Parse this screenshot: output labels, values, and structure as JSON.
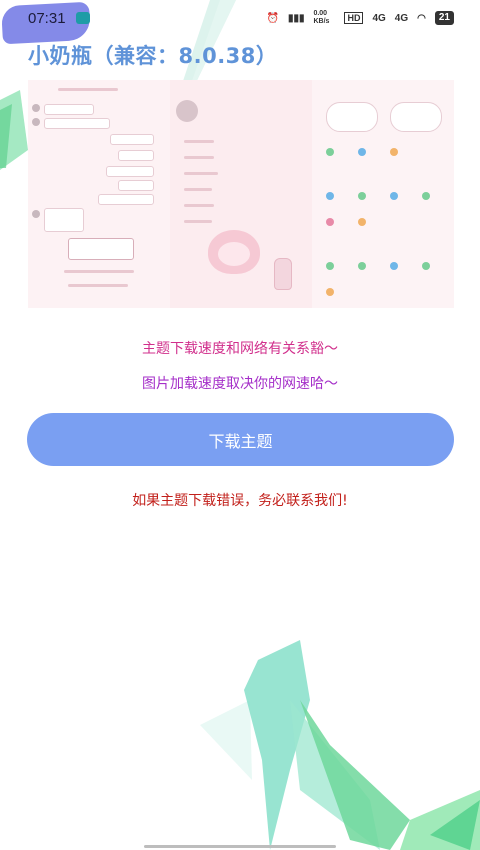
{
  "status_bar": {
    "time": "07:31",
    "network_speed": "0.00 KB/s",
    "hd_label": "HD",
    "signal_1": "4G",
    "signal_2": "4G",
    "battery": "21",
    "icons": [
      "alarm-icon",
      "nfc-icon",
      "wifi-icon",
      "battery-icon",
      "app-notification-icon"
    ]
  },
  "header": {
    "title": "小奶瓶（兼容：8.0.38）"
  },
  "preview": {
    "description_icon": "theme-preview-image"
  },
  "messages": {
    "speed_note": "主题下载速度和网络有关系豁～",
    "image_note": "图片加载速度取决你的网速哈～",
    "error_note": "如果主题下载错误，务必联系我们!"
  },
  "actions": {
    "download_label": "下载主题"
  },
  "colors": {
    "title": "#5f93d8",
    "button": "#7a9ff2",
    "speed_note": "#d12f8c",
    "image_note": "#a52fc9",
    "error_note": "#c2201b",
    "deco_green": "#6fd8a6",
    "deco_teal": "#7fe0d2"
  }
}
